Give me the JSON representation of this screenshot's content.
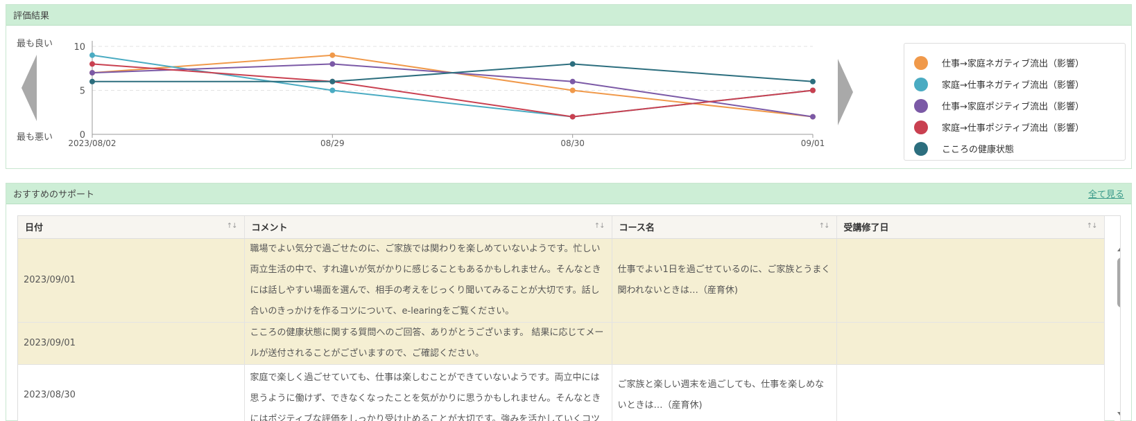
{
  "eval_panel": {
    "title": "評価結果",
    "y_top_label": "最も良い",
    "y_bottom_label": "最も悪い"
  },
  "chart_data": {
    "type": "line",
    "x": [
      "2023/08/02",
      "08/29",
      "08/30",
      "09/01"
    ],
    "yticks": [
      0,
      5,
      10
    ],
    "ylim": [
      0,
      10
    ],
    "grid": "horizontal dashed",
    "legend_position": "right",
    "series": [
      {
        "name": "仕事→家庭ネガティブ流出（影響）",
        "color": "#f0994a",
        "values": [
          7,
          9,
          5,
          2
        ]
      },
      {
        "name": "家庭→仕事ネガティブ流出（影響）",
        "color": "#4aabc2",
        "values": [
          9,
          5,
          2,
          5
        ]
      },
      {
        "name": "仕事→家庭ポジティブ流出（影響）",
        "color": "#7b59a6",
        "values": [
          7,
          8,
          6,
          2
        ]
      },
      {
        "name": "家庭→仕事ポジティブ流出（影響）",
        "color": "#c94050",
        "values": [
          8,
          6,
          2,
          5
        ]
      },
      {
        "name": "こころの健康状態",
        "color": "#2c6e7e",
        "values": [
          6,
          6,
          8,
          6
        ]
      }
    ]
  },
  "support_panel": {
    "title": "おすすめのサポート",
    "see_all": "全て見る",
    "columns": [
      "日付",
      "コメント",
      "コース名",
      "受講修了日"
    ],
    "sort_glyph": "↑↓",
    "rows": [
      {
        "date": "2023/09/01",
        "comment": "職場でよい気分で過ごせたのに、ご家族では関わりを楽しめていないようです。忙しい両立生活の中で、すれ違いが気がかりに感じることもあるかもしれません。そんなときには話しやすい場面を選んで、相手の考えをじっくり聞いてみることが大切です。話し合いのきっかけを作るコツについて、e-learingをご覧ください。",
        "course": "仕事でよい1日を過ごせているのに、ご家族とうまく関われないときは…（産育休)",
        "completed": "",
        "highlight": true
      },
      {
        "date": "2023/09/01",
        "comment": "こころの健康状態に関する質問へのご回答、ありがとうございます。 結果に応じてメールが送付されることがございますので、ご確認ください。",
        "course": "",
        "completed": "",
        "highlight": true
      },
      {
        "date": "2023/08/30",
        "comment": "家庭で楽しく過ごせていても、仕事は楽しむことができていないようです。両立中には思うように働けず、できなくなったことを気がかりに思うかもしれません。そんなときにはポジティブな評価をしっかり受け止めることが大切です。強みを活かしていくコツについて、e-learingをご覧ください。",
        "course": "ご家族と楽しい週末を過ごしても、仕事を楽しめないときは…（産育休)",
        "completed": "",
        "highlight": false
      }
    ]
  }
}
